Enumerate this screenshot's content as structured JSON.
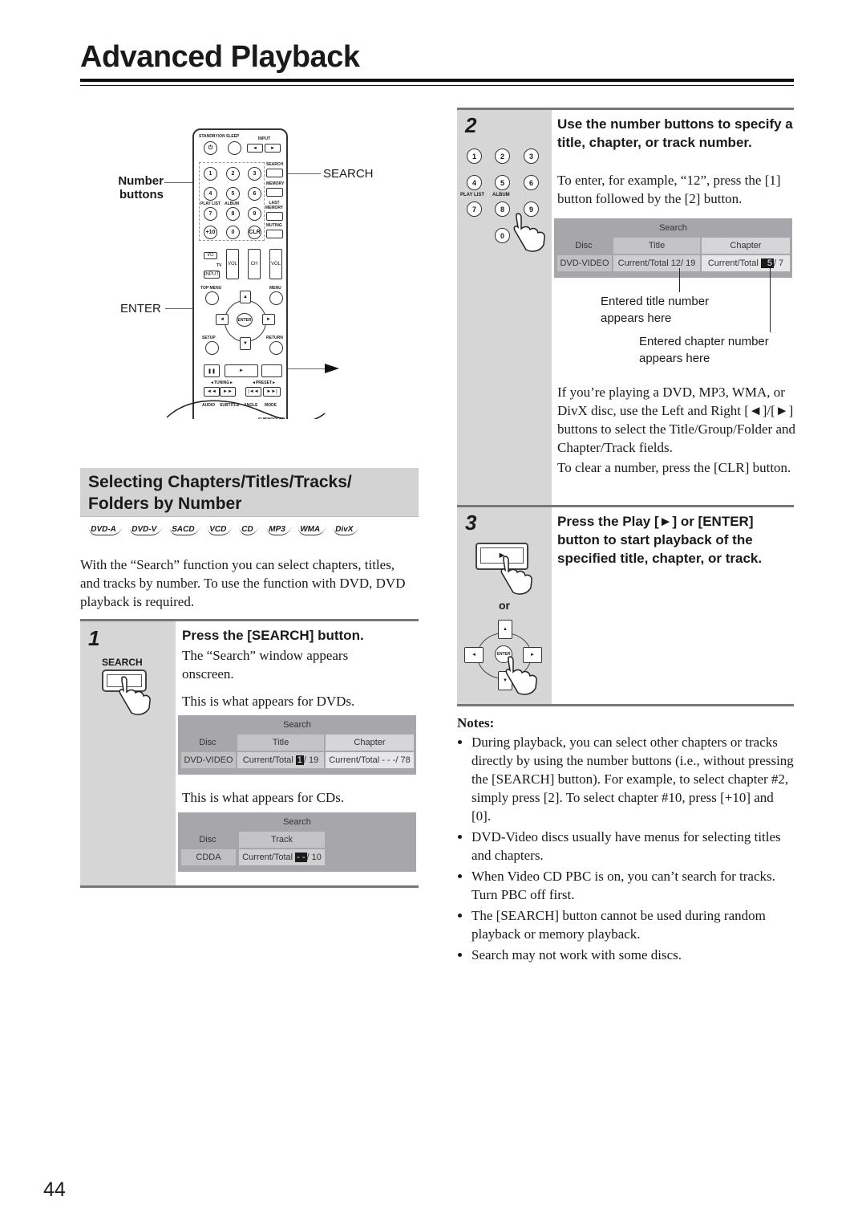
{
  "page": {
    "title": "Advanced Playback",
    "page_number": "44"
  },
  "remote": {
    "callouts": {
      "number_buttons": [
        "Number",
        "buttons"
      ],
      "search": "SEARCH",
      "enter": "ENTER",
      "play_icon": "play-icon"
    },
    "labels": {
      "standby": "STANDBY/ON",
      "sleep": "SLEEP",
      "input": "INPUT",
      "search": "SEARCH",
      "memory": "MEMORY",
      "last_memory": "LAST MEMORY",
      "muting": "MUTING",
      "play_list": "PLAY LIST",
      "album": "ALBUM",
      "clr": "CLR",
      "plus10": "+10",
      "tv": "TV",
      "vol": "VOL",
      "ch": "CH",
      "input_btn": "INPUT",
      "top_menu": "TOP MENU",
      "menu": "MENU",
      "enter": "ENTER",
      "setup": "SETUP",
      "return": "RETURN",
      "tuning": "◄TUNING►",
      "preset": "◄PRESET►",
      "audio": "AUDIO",
      "subtitle": "SUBTITLE",
      "angle": "ANGLE",
      "mode": "MODE",
      "subwoofer": "SUBWOOFER LEVEL"
    },
    "digits": [
      "1",
      "2",
      "3",
      "4",
      "5",
      "6",
      "7",
      "8",
      "9",
      "+10",
      "0",
      "CLR"
    ]
  },
  "section": {
    "heading_line1": "Selecting Chapters/Titles/Tracks/",
    "heading_line2": "Folders by Number",
    "disc_types": [
      "DVD-A",
      "DVD-V",
      "SACD",
      "VCD",
      "CD",
      "MP3",
      "WMA",
      "DivX"
    ],
    "intro": "With the “Search” function you can select chapters, titles, and tracks by number. To use the function with DVD, DVD playback is required."
  },
  "step1": {
    "number": "1",
    "button_label": "SEARCH",
    "title": "Press the [SEARCH] button.",
    "text1": "The “Search” window appears onscreen.",
    "text_dvd": "This is what appears for DVDs.",
    "text_cd": "This is what appears for CDs.",
    "osd_dvd": {
      "header": "Search",
      "col_disc": "Disc",
      "col_title": "Title",
      "col_chapter": "Chapter",
      "disc_value": "DVD-VIDEO",
      "title_prefix": "Current/Total",
      "title_current": "1",
      "title_total": "/  19",
      "chapter_prefix": "Current/Total",
      "chapter_current": "- - -",
      "chapter_total": "/  78"
    },
    "osd_cd": {
      "header": "Search",
      "col_disc": "Disc",
      "col_track": "Track",
      "disc_value": "CDDA",
      "track_prefix": "Current/Total",
      "track_current": "- -",
      "track_total": "/ 10"
    }
  },
  "step2": {
    "number": "2",
    "keypad": [
      "1",
      "2",
      "3",
      "4",
      "5",
      "6",
      "7",
      "8",
      "9",
      "0"
    ],
    "keypad_labels": {
      "play_list": "PLAY LIST",
      "album": "ALBUM"
    },
    "title": "Use the number buttons to specify a title, chapter, or track number.",
    "text1": "To enter, for example, “12”, press the [1] button followed by the [2] button.",
    "osd": {
      "header": "Search",
      "col_disc": "Disc",
      "col_title": "Title",
      "col_chapter": "Chapter",
      "disc_value": "DVD-VIDEO",
      "title_prefix": "Current/Total",
      "title_current": "12",
      "title_total": "/  19",
      "chapter_prefix": "Current/Total",
      "chapter_current": "5",
      "chapter_total": "/  7"
    },
    "annotation_title": "Entered title number appears here",
    "annotation_chapter": "Entered chapter number appears here",
    "text2": "If you’re playing a DVD, MP3, WMA, or DivX disc, use the Left and Right [◄]/[►] buttons to select the Title/Group/Folder and Chapter/Track fields.",
    "text3": "To clear a number, press the [CLR] button."
  },
  "step3": {
    "number": "3",
    "or_label": "or",
    "enter_label": "ENTER",
    "title": "Press the Play [►] or [ENTER] button to start playback of the specified title, chapter, or track."
  },
  "notes": {
    "heading": "Notes:",
    "items": [
      "During playback, you can select other chapters or tracks directly by using the number buttons (i.e., without pressing the [SEARCH] button). For example, to select chapter #2, simply press [2]. To select chapter #10, press [+10] and [0].",
      "DVD-Video discs usually have menus for selecting titles and chapters.",
      "When Video CD PBC is on, you can’t search for tracks. Turn PBC off first.",
      "The [SEARCH] button cannot be used during random playback or memory playback.",
      "Search may not work with some discs."
    ]
  }
}
